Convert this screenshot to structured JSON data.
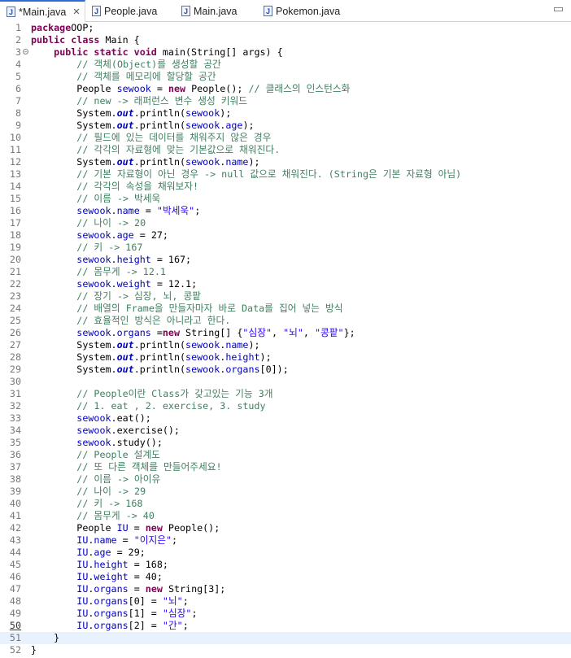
{
  "tabs": [
    {
      "label": "*Main.java",
      "active": true,
      "close": "✕"
    },
    {
      "label": "People.java",
      "active": false
    },
    {
      "label": "Main.java",
      "active": false
    },
    {
      "label": "Pokemon.java",
      "active": false
    }
  ],
  "file_icon_glyph": "J",
  "current_line": 51,
  "lines": [
    {
      "n": "1",
      "t": [
        [
          "kw",
          "package"
        ],
        [
          "",
          "OOP;"
        ]
      ]
    },
    {
      "n": "2",
      "t": [
        [
          "kw",
          "public class"
        ],
        [
          "",
          " Main {"
        ]
      ]
    },
    {
      "n": "3",
      "fold": true,
      "t": [
        [
          "",
          "    "
        ],
        [
          "kw",
          "public static void"
        ],
        [
          "",
          " main(String[] args) {"
        ]
      ]
    },
    {
      "n": "4",
      "t": [
        [
          "",
          "        "
        ],
        [
          "cm",
          "// 객체(Object)를 생성할 공간"
        ]
      ]
    },
    {
      "n": "5",
      "t": [
        [
          "",
          "        "
        ],
        [
          "cm",
          "// 객체를 메모리에 할당할 공간"
        ]
      ]
    },
    {
      "n": "6",
      "t": [
        [
          "",
          "        People "
        ],
        [
          "fd",
          "sewook"
        ],
        [
          "",
          " = "
        ],
        [
          "kw",
          "new"
        ],
        [
          "",
          " People(); "
        ],
        [
          "cm",
          "// 클래스의 인스턴스화"
        ]
      ]
    },
    {
      "n": "7",
      "t": [
        [
          "",
          "        "
        ],
        [
          "cm",
          "// new -> 래퍼런스 변수 생성 키워드"
        ]
      ]
    },
    {
      "n": "8",
      "t": [
        [
          "",
          "        System."
        ],
        [
          "sf",
          "out"
        ],
        [
          "",
          ".println("
        ],
        [
          "fd",
          "sewook"
        ],
        [
          "",
          ");"
        ]
      ]
    },
    {
      "n": "9",
      "t": [
        [
          "",
          "        System."
        ],
        [
          "sf",
          "out"
        ],
        [
          "",
          ".println("
        ],
        [
          "fd",
          "sewook"
        ],
        [
          "",
          "."
        ],
        [
          "fd",
          "age"
        ],
        [
          "",
          ");"
        ]
      ]
    },
    {
      "n": "10",
      "t": [
        [
          "",
          "        "
        ],
        [
          "cm",
          "// 필드에 있는 데이터를 채워주지 않은 경우"
        ]
      ]
    },
    {
      "n": "11",
      "t": [
        [
          "",
          "        "
        ],
        [
          "cm",
          "// 각각의 자료형에 맞는 기본값으로 채워진다."
        ]
      ]
    },
    {
      "n": "12",
      "t": [
        [
          "",
          "        System."
        ],
        [
          "sf",
          "out"
        ],
        [
          "",
          ".println("
        ],
        [
          "fd",
          "sewook"
        ],
        [
          "",
          "."
        ],
        [
          "fd",
          "name"
        ],
        [
          "",
          ");"
        ]
      ]
    },
    {
      "n": "13",
      "t": [
        [
          "",
          "        "
        ],
        [
          "cm",
          "// 기본 자료형이 아닌 경우 -> null 값으로 채워진다. (String은 기본 자료형 아님)"
        ]
      ]
    },
    {
      "n": "14",
      "t": [
        [
          "",
          "        "
        ],
        [
          "cm",
          "// 각각의 속성을 채워보자!"
        ]
      ]
    },
    {
      "n": "15",
      "t": [
        [
          "",
          "        "
        ],
        [
          "cm",
          "// 이름 -> 박세욱"
        ]
      ]
    },
    {
      "n": "16",
      "t": [
        [
          "",
          "        "
        ],
        [
          "fd",
          "sewook"
        ],
        [
          "",
          "."
        ],
        [
          "fd",
          "name"
        ],
        [
          "",
          " = "
        ],
        [
          "st",
          "\"박세욱\""
        ],
        [
          "",
          ";"
        ]
      ]
    },
    {
      "n": "17",
      "t": [
        [
          "",
          "        "
        ],
        [
          "cm",
          "// 나이 -> 20"
        ]
      ]
    },
    {
      "n": "18",
      "t": [
        [
          "",
          "        "
        ],
        [
          "fd",
          "sewook"
        ],
        [
          "",
          "."
        ],
        [
          "fd",
          "age"
        ],
        [
          "",
          " = 27;"
        ]
      ]
    },
    {
      "n": "19",
      "t": [
        [
          "",
          "        "
        ],
        [
          "cm",
          "// 키 -> 167"
        ]
      ]
    },
    {
      "n": "20",
      "t": [
        [
          "",
          "        "
        ],
        [
          "fd",
          "sewook"
        ],
        [
          "",
          "."
        ],
        [
          "fd",
          "height"
        ],
        [
          "",
          " = 167;"
        ]
      ]
    },
    {
      "n": "21",
      "t": [
        [
          "",
          "        "
        ],
        [
          "cm",
          "// 몸무게 -> 12.1"
        ]
      ]
    },
    {
      "n": "22",
      "t": [
        [
          "",
          "        "
        ],
        [
          "fd",
          "sewook"
        ],
        [
          "",
          "."
        ],
        [
          "fd",
          "weight"
        ],
        [
          "",
          " = 12.1;"
        ]
      ]
    },
    {
      "n": "23",
      "t": [
        [
          "",
          "        "
        ],
        [
          "cm",
          "// 장기 -> 심장, 뇌, 콩팥"
        ]
      ]
    },
    {
      "n": "24",
      "t": [
        [
          "",
          "        "
        ],
        [
          "cm",
          "// 배열의 Frame을 만들자마자 바로 Data를 집어 넣는 방식"
        ]
      ]
    },
    {
      "n": "25",
      "t": [
        [
          "",
          "        "
        ],
        [
          "cm",
          "// 효율적인 방식은 아니라고 한다."
        ]
      ]
    },
    {
      "n": "26",
      "t": [
        [
          "",
          "        "
        ],
        [
          "fd",
          "sewook"
        ],
        [
          "",
          "."
        ],
        [
          "fd",
          "organs"
        ],
        [
          "",
          " ="
        ],
        [
          "kw",
          "new"
        ],
        [
          "",
          " String[] {"
        ],
        [
          "st",
          "\"심장\""
        ],
        [
          "",
          ", "
        ],
        [
          "st",
          "\"뇌\""
        ],
        [
          "",
          ", "
        ],
        [
          "st",
          "\"콩팥\""
        ],
        [
          "",
          "};"
        ]
      ]
    },
    {
      "n": "27",
      "t": [
        [
          "",
          "        System."
        ],
        [
          "sf",
          "out"
        ],
        [
          "",
          ".println("
        ],
        [
          "fd",
          "sewook"
        ],
        [
          "",
          "."
        ],
        [
          "fd",
          "name"
        ],
        [
          "",
          ");"
        ]
      ]
    },
    {
      "n": "28",
      "t": [
        [
          "",
          "        System."
        ],
        [
          "sf",
          "out"
        ],
        [
          "",
          ".println("
        ],
        [
          "fd",
          "sewook"
        ],
        [
          "",
          "."
        ],
        [
          "fd",
          "height"
        ],
        [
          "",
          ");"
        ]
      ]
    },
    {
      "n": "29",
      "t": [
        [
          "",
          "        System."
        ],
        [
          "sf",
          "out"
        ],
        [
          "",
          ".println("
        ],
        [
          "fd",
          "sewook"
        ],
        [
          "",
          "."
        ],
        [
          "fd",
          "organs"
        ],
        [
          "",
          "[0]);"
        ]
      ]
    },
    {
      "n": "30",
      "t": []
    },
    {
      "n": "31",
      "t": [
        [
          "",
          "        "
        ],
        [
          "cm",
          "// People이란 Class가 갖고있는 기능 3개"
        ]
      ]
    },
    {
      "n": "32",
      "t": [
        [
          "",
          "        "
        ],
        [
          "cm",
          "// 1. eat , 2. exercise, 3. study"
        ]
      ]
    },
    {
      "n": "33",
      "t": [
        [
          "",
          "        "
        ],
        [
          "fd",
          "sewook"
        ],
        [
          "",
          ".eat();"
        ]
      ]
    },
    {
      "n": "34",
      "t": [
        [
          "",
          "        "
        ],
        [
          "fd",
          "sewook"
        ],
        [
          "",
          ".exercise();"
        ]
      ]
    },
    {
      "n": "35",
      "t": [
        [
          "",
          "        "
        ],
        [
          "fd",
          "sewook"
        ],
        [
          "",
          ".study();"
        ]
      ]
    },
    {
      "n": "36",
      "t": [
        [
          "",
          "        "
        ],
        [
          "cm",
          "// People 설계도"
        ]
      ]
    },
    {
      "n": "37",
      "t": [
        [
          "",
          "        "
        ],
        [
          "cm",
          "// 또 다른 객체를 만들어주세요!"
        ]
      ]
    },
    {
      "n": "38",
      "t": [
        [
          "",
          "        "
        ],
        [
          "cm",
          "// 이름 -> 아이유"
        ]
      ]
    },
    {
      "n": "39",
      "t": [
        [
          "",
          "        "
        ],
        [
          "cm",
          "// 나이 -> 29"
        ]
      ]
    },
    {
      "n": "40",
      "t": [
        [
          "",
          "        "
        ],
        [
          "cm",
          "// 키 -> 168"
        ]
      ]
    },
    {
      "n": "41",
      "t": [
        [
          "",
          "        "
        ],
        [
          "cm",
          "// 몸무게 -> 40"
        ]
      ]
    },
    {
      "n": "42",
      "t": [
        [
          "",
          "        People "
        ],
        [
          "fd",
          "IU"
        ],
        [
          "",
          " = "
        ],
        [
          "kw",
          "new"
        ],
        [
          "",
          " People();"
        ]
      ]
    },
    {
      "n": "43",
      "t": [
        [
          "",
          "        "
        ],
        [
          "fd",
          "IU"
        ],
        [
          "",
          "."
        ],
        [
          "fd",
          "name"
        ],
        [
          "",
          " = "
        ],
        [
          "st",
          "\"이지은\""
        ],
        [
          "",
          ";"
        ]
      ]
    },
    {
      "n": "44",
      "t": [
        [
          "",
          "        "
        ],
        [
          "fd",
          "IU"
        ],
        [
          "",
          "."
        ],
        [
          "fd",
          "age"
        ],
        [
          "",
          " = 29;"
        ]
      ]
    },
    {
      "n": "45",
      "t": [
        [
          "",
          "        "
        ],
        [
          "fd",
          "IU"
        ],
        [
          "",
          "."
        ],
        [
          "fd",
          "height"
        ],
        [
          "",
          " = 168;"
        ]
      ]
    },
    {
      "n": "46",
      "t": [
        [
          "",
          "        "
        ],
        [
          "fd",
          "IU"
        ],
        [
          "",
          "."
        ],
        [
          "fd",
          "weight"
        ],
        [
          "",
          " = 40;"
        ]
      ]
    },
    {
      "n": "47",
      "t": [
        [
          "",
          "        "
        ],
        [
          "fd",
          "IU"
        ],
        [
          "",
          "."
        ],
        [
          "fd",
          "organs"
        ],
        [
          "",
          " = "
        ],
        [
          "kw",
          "new"
        ],
        [
          "",
          " String[3];"
        ]
      ]
    },
    {
      "n": "48",
      "t": [
        [
          "",
          "        "
        ],
        [
          "fd",
          "IU"
        ],
        [
          "",
          "."
        ],
        [
          "fd",
          "organs"
        ],
        [
          "",
          "[0] = "
        ],
        [
          "st",
          "\"뇌\""
        ],
        [
          "",
          ";"
        ]
      ]
    },
    {
      "n": "49",
      "t": [
        [
          "",
          "        "
        ],
        [
          "fd",
          "IU"
        ],
        [
          "",
          "."
        ],
        [
          "fd",
          "organs"
        ],
        [
          "",
          "[1] = "
        ],
        [
          "st",
          "\"심장\""
        ],
        [
          "",
          ";"
        ]
      ]
    },
    {
      "n": "50",
      "t": [
        [
          "",
          "        "
        ],
        [
          "fd",
          "IU"
        ],
        [
          "",
          "."
        ],
        [
          "fd",
          "organs"
        ],
        [
          "",
          "[2] = "
        ],
        [
          "st",
          "\"간\""
        ],
        [
          "",
          ";"
        ]
      ]
    },
    {
      "n": "51",
      "t": [
        [
          "",
          "    }"
        ]
      ]
    },
    {
      "n": "52",
      "t": [
        [
          "",
          "}"
        ]
      ]
    }
  ]
}
